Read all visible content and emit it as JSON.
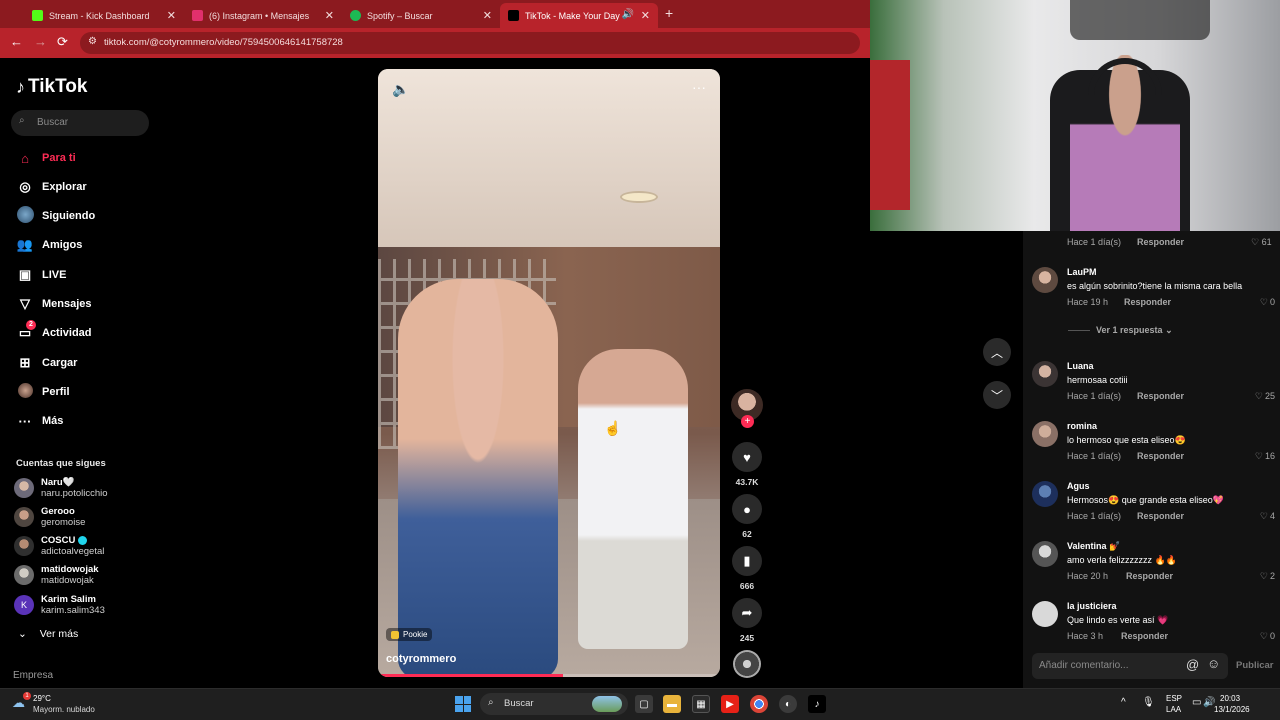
{
  "browser": {
    "tabs": [
      {
        "title": "Stream - Kick Dashboard",
        "color": "#53fc18"
      },
      {
        "title": "(6) Instagram • Mensajes",
        "color": "#e1306c"
      },
      {
        "title": "Spotify – Buscar",
        "color": "#1db954"
      },
      {
        "title": "TikTok - Make Your Day",
        "color": "#000000"
      }
    ],
    "url": "tiktok.com/@cotyrommero/video/7594500646141758728",
    "theme_color": "#b8232b"
  },
  "sidebar": {
    "logo": "TikTok",
    "search_placeholder": "Buscar",
    "nav": [
      {
        "label": "Para ti",
        "icon": "home-icon"
      },
      {
        "label": "Explorar",
        "icon": "compass-icon"
      },
      {
        "label": "Siguiendo",
        "icon": "following-avatar-icon"
      },
      {
        "label": "Amigos",
        "icon": "friends-icon"
      },
      {
        "label": "LIVE",
        "icon": "live-icon"
      },
      {
        "label": "Mensajes",
        "icon": "send-icon"
      },
      {
        "label": "Actividad",
        "icon": "activity-icon",
        "badge": "2"
      },
      {
        "label": "Cargar",
        "icon": "upload-icon"
      },
      {
        "label": "Perfil",
        "icon": "profile-icon"
      },
      {
        "label": "Más",
        "icon": "more-icon"
      }
    ],
    "following_title": "Cuentas que sigues",
    "accounts": [
      {
        "name": "Naru🤍",
        "handle": "naru.potolicchio"
      },
      {
        "name": "Gerooo",
        "handle": "geromoise"
      },
      {
        "name": "COSCU",
        "handle": "adictoalvegetal",
        "verified": true
      },
      {
        "name": "matidowojak",
        "handle": "matidowojak"
      },
      {
        "name": "Karim Salim",
        "handle": "karim.salim343",
        "initial": "K"
      }
    ],
    "see_more": "Ver más",
    "footer": "Empresa",
    "accent": "#fe2c55"
  },
  "video": {
    "author": "cotyrommero",
    "sound_tag": "Pookie",
    "progress": 0.54,
    "likes": "43.7K",
    "comments": "62",
    "saves": "666",
    "shares": "245"
  },
  "comments": {
    "first": {
      "meta": "Hace 1 día(s)",
      "reply": "Responder",
      "likes": "61"
    },
    "items": [
      {
        "user": "LauPM",
        "text": "es algún sobrinito?tiene la misma cara bella",
        "meta": "Hace 19 h",
        "reply": "Responder",
        "likes": "0"
      },
      {
        "user": "Luana",
        "text": "hermosaa cotiii",
        "meta": "Hace 1 día(s)",
        "reply": "Responder",
        "likes": "25"
      },
      {
        "user": "romina",
        "text": "lo hermoso que esta eliseo😍",
        "meta": "Hace 1 día(s)",
        "reply": "Responder",
        "likes": "16"
      },
      {
        "user": "Agus",
        "text": "Hermosos😍 que grande esta eliseo💖",
        "meta": "Hace 1 día(s)",
        "reply": "Responder",
        "likes": "4"
      },
      {
        "user": "Valentina 💅",
        "text": "amo verla felizzzzzzz 🔥🔥",
        "meta": "Hace 20 h",
        "reply": "Responder",
        "likes": "2"
      },
      {
        "user": "la justiciera",
        "text": "Que lindo es verte así 💗",
        "meta": "Hace 3 h",
        "reply": "Responder",
        "likes": "0"
      }
    ],
    "view_replies": "Ver 1 respuesta",
    "input_placeholder": "Añadir comentario...",
    "publish": "Publicar"
  },
  "taskbar": {
    "weather_temp": "29°C",
    "weather_desc": "Mayorm. nublado",
    "weather_badge": "1",
    "search": "Buscar",
    "lang1": "ESP",
    "lang2": "LAA",
    "time": "20:03",
    "date": "13/1/2026"
  }
}
